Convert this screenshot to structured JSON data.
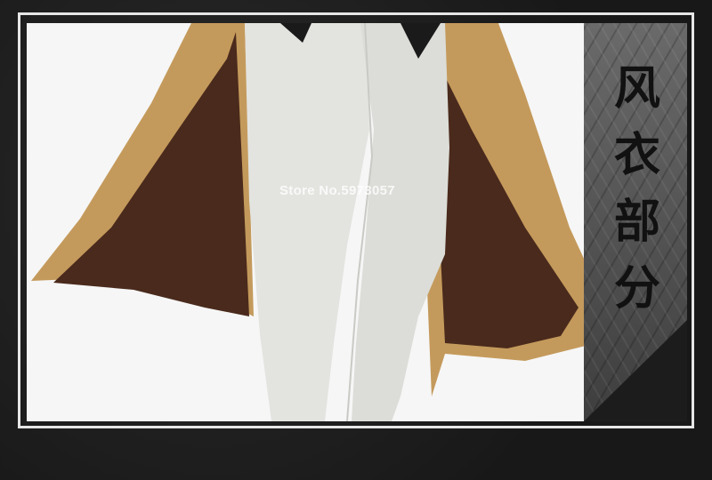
{
  "section_label": [
    "风",
    "衣",
    "部",
    "分"
  ],
  "watermark": "Store No.5973057",
  "colors": {
    "coat_outer": "#c49a5c",
    "coat_lining": "#4a2a1c",
    "pants": "#e3e4e0",
    "background": "#f6f6f6",
    "panel": "#555555"
  }
}
